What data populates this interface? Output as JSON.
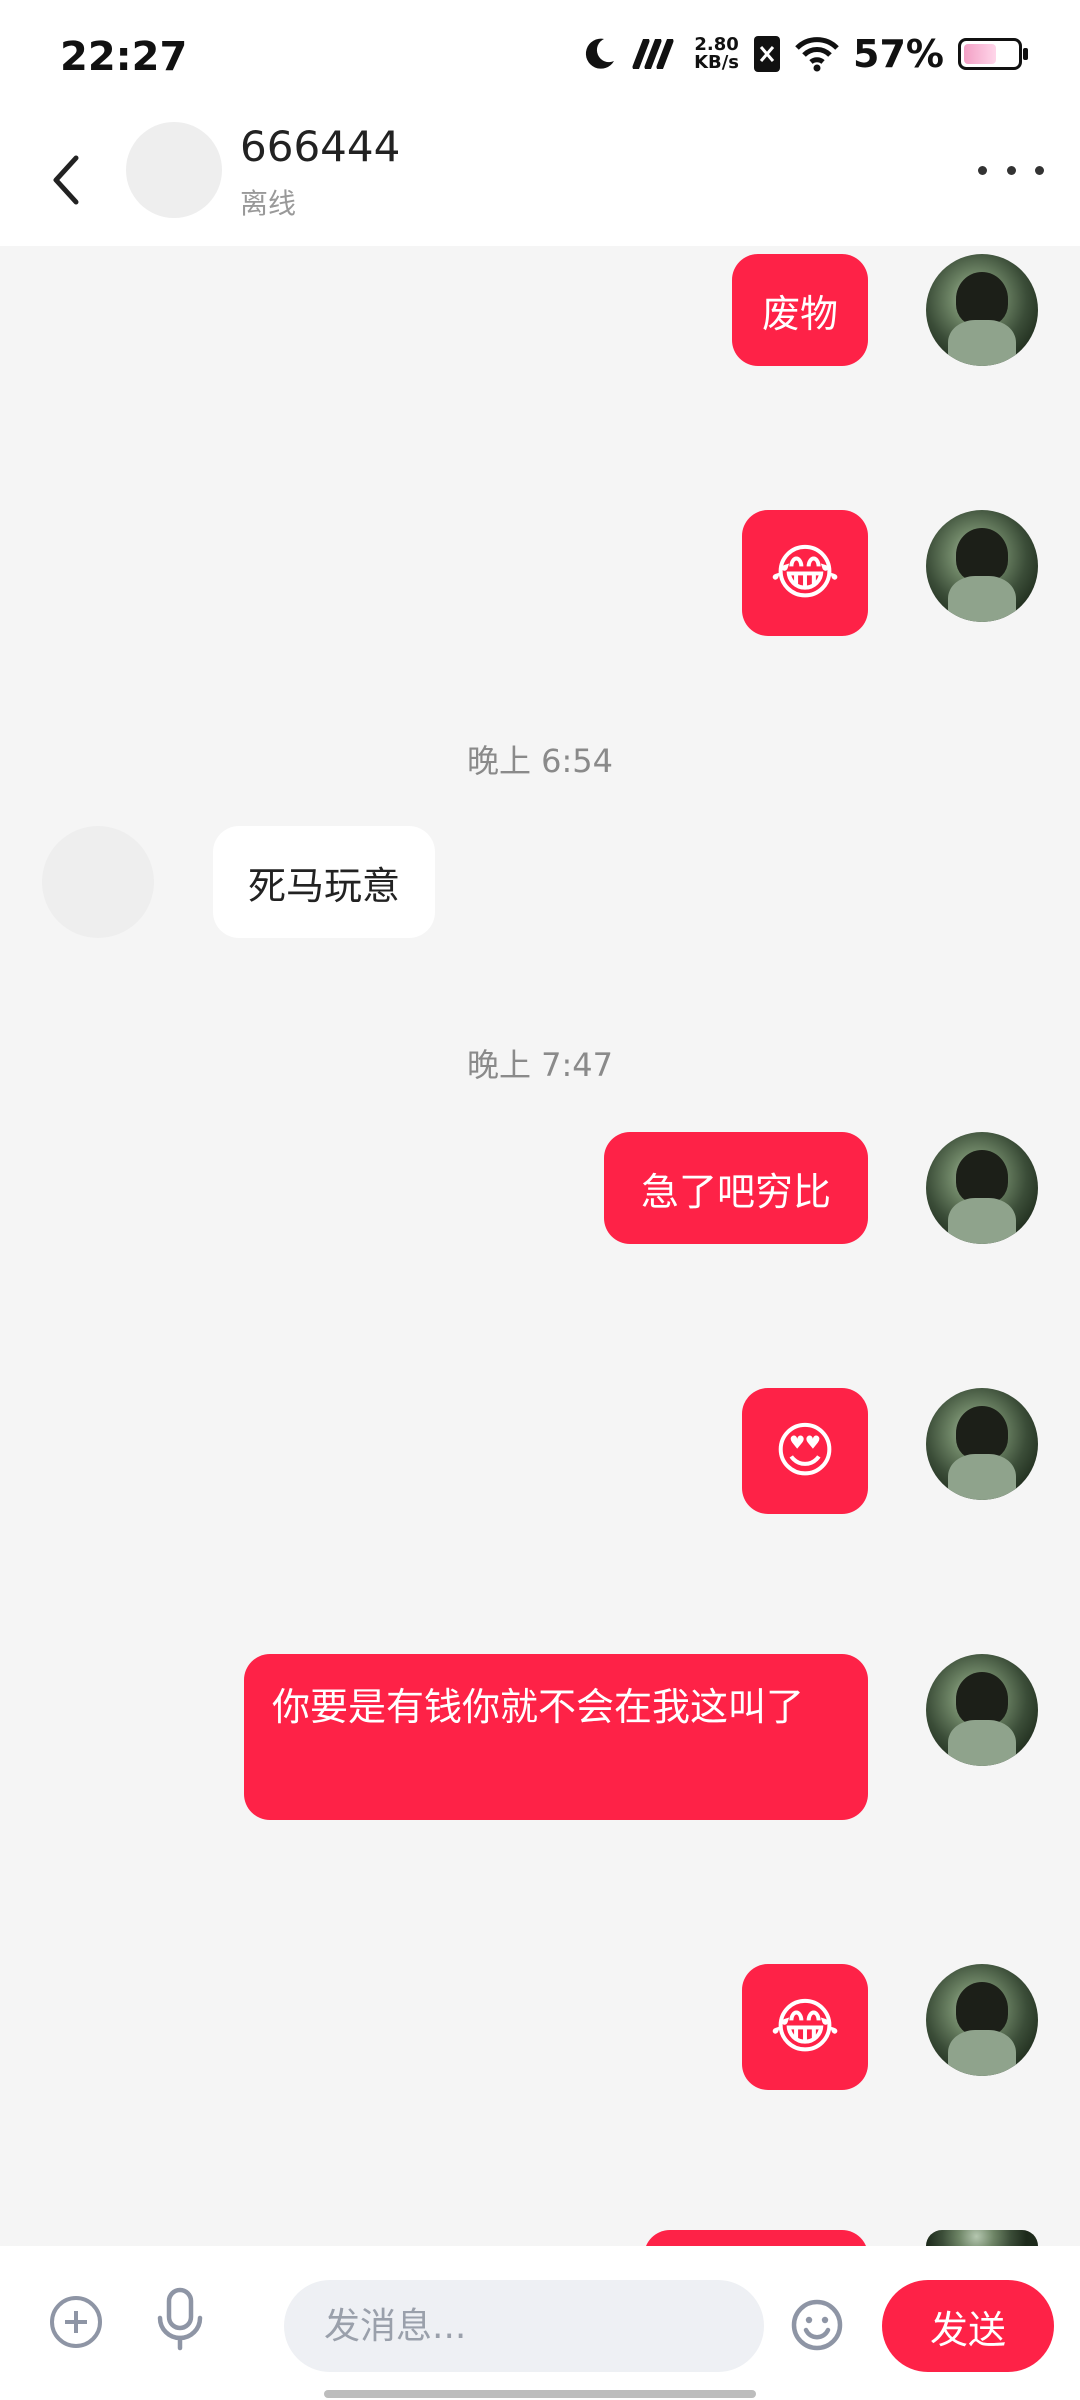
{
  "status_bar": {
    "time": "22:27",
    "net_speed_value": "2.80",
    "net_speed_unit": "KB/s",
    "battery_percent": "57%",
    "icons": [
      "moon-icon",
      "signal-icon",
      "sim-off-icon",
      "wifi-icon",
      "battery-icon"
    ]
  },
  "header": {
    "peer_name": "666444",
    "peer_status": "离线"
  },
  "messages": [
    {
      "direction": "out",
      "text": "废物"
    },
    {
      "direction": "out",
      "emoji": "😂"
    },
    {
      "timestamp": "晚上 6:54"
    },
    {
      "direction": "in",
      "text": "死马玩意"
    },
    {
      "timestamp": "晚上 7:47"
    },
    {
      "direction": "out",
      "text": "急了吧穷比"
    },
    {
      "direction": "out",
      "emoji": "😍"
    },
    {
      "direction": "out",
      "text": "你要是有钱你就不会在我这叫了"
    },
    {
      "direction": "out",
      "emoji": "😂"
    }
  ],
  "composer": {
    "placeholder": "发消息...",
    "send_label": "发送"
  },
  "colors": {
    "accent": "#fe2247",
    "background": "#f5f5f5",
    "muted_text": "#8a8a8a"
  }
}
